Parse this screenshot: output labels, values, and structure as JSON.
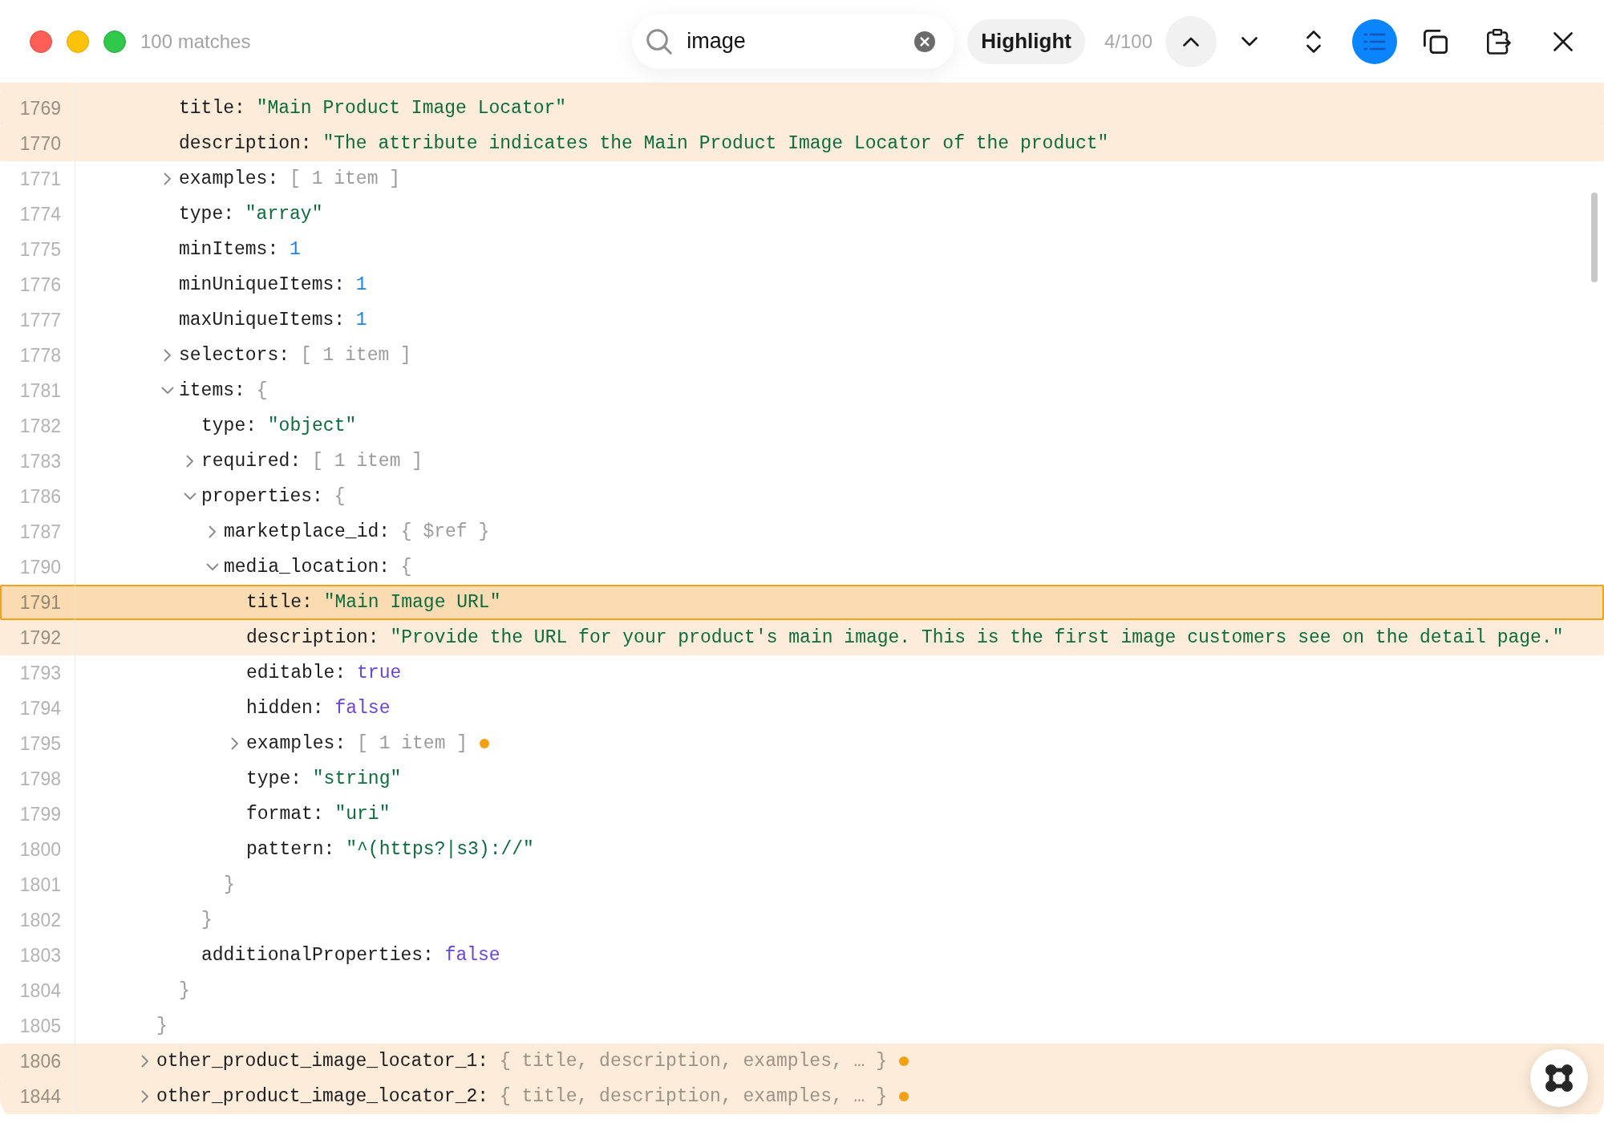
{
  "window": {
    "match_count": "100 matches"
  },
  "search": {
    "value": "image",
    "highlight_label": "Highlight",
    "position": "4/100"
  },
  "view_toggle": {
    "on": true
  },
  "tree": [
    {
      "match": true,
      "selected": false,
      "children": [
        {
          "line": "1769",
          "key": "title:",
          "kind": "string",
          "value": "\"Main Product Image Locator\"",
          "match": true,
          "selected": false
        },
        {
          "line": "1770",
          "key": "description:",
          "kind": "string",
          "value": "\"The attribute indicates the Main Product Image Locator of the product\"",
          "match": true,
          "selected": false
        },
        {
          "line": "1771",
          "key": "examples:",
          "kind": "branch",
          "expanded": false,
          "summary": "[ 1 item ]",
          "hidden_match": false,
          "match": false,
          "selected": false
        },
        {
          "line": "1774",
          "key": "type:",
          "kind": "string",
          "value": "\"array\"",
          "match": false,
          "selected": false
        },
        {
          "line": "1775",
          "key": "minItems:",
          "kind": "number",
          "value": "1",
          "match": false,
          "selected": false
        },
        {
          "line": "1776",
          "key": "minUniqueItems:",
          "kind": "number",
          "value": "1",
          "match": false,
          "selected": false
        },
        {
          "line": "1777",
          "key": "maxUniqueItems:",
          "kind": "number",
          "value": "1",
          "match": false,
          "selected": false
        },
        {
          "line": "1778",
          "key": "selectors:",
          "kind": "branch",
          "expanded": false,
          "summary": "[ 1 item ]",
          "hidden_match": false,
          "match": false,
          "selected": false
        },
        {
          "line": "1781",
          "key": "items:",
          "kind": "branch",
          "expanded": true,
          "open": "{",
          "match": false,
          "selected": false,
          "children": [
            {
              "line": "1782",
              "key": "type:",
              "kind": "string",
              "value": "\"object\"",
              "match": false,
              "selected": false
            },
            {
              "line": "1783",
              "key": "required:",
              "kind": "branch",
              "expanded": false,
              "summary": "[ 1 item ]",
              "hidden_match": false,
              "match": false,
              "selected": false
            },
            {
              "line": "1786",
              "key": "properties:",
              "kind": "branch",
              "expanded": true,
              "open": "{",
              "match": false,
              "selected": false,
              "children": [
                {
                  "line": "1787",
                  "key": "marketplace_id:",
                  "kind": "branch",
                  "expanded": false,
                  "summary": "{ $ref }",
                  "hidden_match": false,
                  "match": false,
                  "selected": false
                },
                {
                  "line": "1790",
                  "key": "media_location:",
                  "kind": "branch",
                  "expanded": true,
                  "open": "{",
                  "match": false,
                  "selected": false,
                  "children": [
                    {
                      "line": "1791",
                      "key": "title:",
                      "kind": "string",
                      "value": "\"Main Image URL\"",
                      "match": true,
                      "selected": true
                    },
                    {
                      "line": "1792",
                      "key": "description:",
                      "kind": "string",
                      "value": "\"Provide the URL for your product's main image. This is the first image customers see on the detail page.\"",
                      "match": true,
                      "selected": false
                    },
                    {
                      "line": "1793",
                      "key": "editable:",
                      "kind": "boolean",
                      "value": "true",
                      "match": false,
                      "selected": false
                    },
                    {
                      "line": "1794",
                      "key": "hidden:",
                      "kind": "boolean",
                      "value": "false",
                      "match": false,
                      "selected": false
                    },
                    {
                      "line": "1795",
                      "key": "examples:",
                      "kind": "branch",
                      "expanded": false,
                      "summary": "[ 1 item ]",
                      "hidden_match": true,
                      "match": false,
                      "selected": false
                    },
                    {
                      "line": "1798",
                      "key": "type:",
                      "kind": "string",
                      "value": "\"string\"",
                      "match": false,
                      "selected": false
                    },
                    {
                      "line": "1799",
                      "key": "format:",
                      "kind": "string",
                      "value": "\"uri\"",
                      "match": false,
                      "selected": false
                    },
                    {
                      "line": "1800",
                      "key": "pattern:",
                      "kind": "string",
                      "value": "\"^(https?|s3)://\"",
                      "match": false,
                      "selected": false
                    }
                  ],
                  "close": {
                    "line": "1801",
                    "text": "}"
                  }
                }
              ],
              "close": {
                "line": "1802",
                "text": "}"
              }
            },
            {
              "line": "1803",
              "key": "additionalProperties:",
              "kind": "boolean",
              "value": "false",
              "match": false,
              "selected": false
            }
          ],
          "close": {
            "line": "1804",
            "text": "}"
          }
        }
      ],
      "close": {
        "line": "1805",
        "text": "}"
      }
    },
    {
      "line": "1806",
      "key": "other_product_image_locator_1:",
      "kind": "branch",
      "expanded": false,
      "summary": "{ title, description, examples, … }",
      "hidden_match": true,
      "match": true,
      "selected": false
    },
    {
      "line": "1844",
      "key": "other_product_image_locator_2:",
      "kind": "branch",
      "expanded": false,
      "summary": "{ title, description, examples, … }",
      "hidden_match": true,
      "match": true,
      "selected": false
    }
  ]
}
